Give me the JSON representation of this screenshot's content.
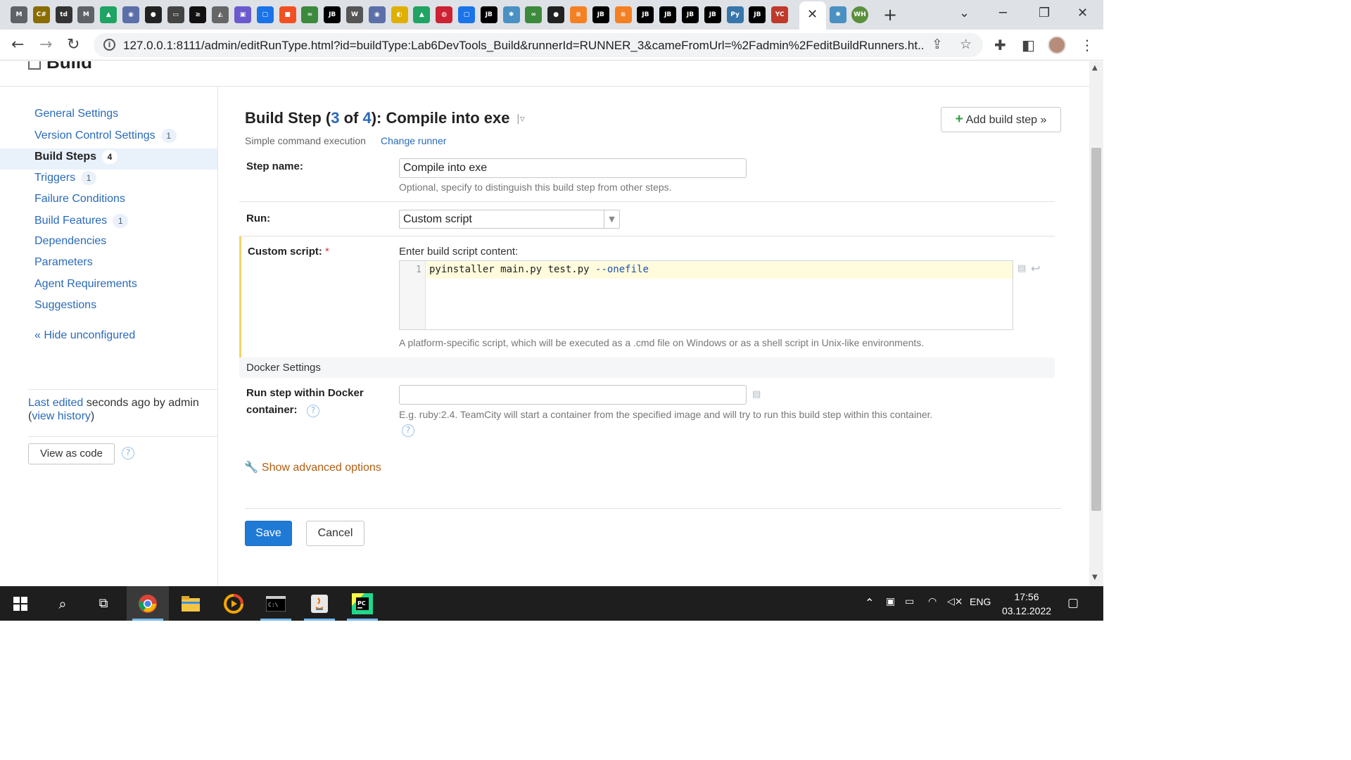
{
  "browser": {
    "tab_close": "✕",
    "new_tab": "+",
    "url": "127.0.0.1:8111/admin/editRunType.html?id=buildType:Lab6DevTools_Build&runnerId=RUNNER_3&cameFromUrl=%2Fadmin%2FeditBuildRunners.ht...",
    "pinned_tabs": [
      {
        "label": "M",
        "color": "#5f6368"
      },
      {
        "label": "C#",
        "color": "#8a6d00"
      },
      {
        "label": "td",
        "color": "#333333"
      },
      {
        "label": "M",
        "color": "#5f6368"
      },
      {
        "label": "▲",
        "color": "#1fa463"
      },
      {
        "label": "◉",
        "color": "#5b6fa8"
      },
      {
        "label": "●",
        "color": "#222222"
      },
      {
        "label": "▭",
        "color": "#444444"
      },
      {
        "label": "≥",
        "color": "#111111"
      },
      {
        "label": "◭",
        "color": "#666666"
      },
      {
        "label": "▣",
        "color": "#6a5acd"
      },
      {
        "label": "▢",
        "color": "#1a73e8"
      },
      {
        "label": "■",
        "color": "#f25022"
      },
      {
        "label": "∞",
        "color": "#3c8a3c"
      },
      {
        "label": "JB",
        "color": "#000000"
      },
      {
        "label": "W",
        "color": "#555555"
      },
      {
        "label": "◉",
        "color": "#5b6fa8"
      },
      {
        "label": "◐",
        "color": "#e0b000"
      },
      {
        "label": "▲",
        "color": "#1fa463"
      },
      {
        "label": "◍",
        "color": "#cc2233"
      },
      {
        "label": "▢",
        "color": "#1a73e8"
      },
      {
        "label": "JB",
        "color": "#000000"
      },
      {
        "label": "✱",
        "color": "#4a90c2"
      },
      {
        "label": "∞",
        "color": "#3c8a3c"
      },
      {
        "label": "●",
        "color": "#222222"
      },
      {
        "label": "≋",
        "color": "#f48024"
      },
      {
        "label": "JB",
        "color": "#000000"
      },
      {
        "label": "≋",
        "color": "#f48024"
      },
      {
        "label": "JB",
        "color": "#000000"
      },
      {
        "label": "JB",
        "color": "#000000"
      },
      {
        "label": "JB",
        "color": "#000000"
      },
      {
        "label": "JB",
        "color": "#000000"
      },
      {
        "label": "Py",
        "color": "#3776ab"
      },
      {
        "label": "JB",
        "color": "#000000"
      },
      {
        "label": "YC",
        "color": "#c0392b"
      }
    ],
    "extra_tabs": [
      {
        "label": "✱",
        "color": "#4a90c2"
      },
      {
        "label": "WH",
        "color": "#5a8f3c"
      }
    ]
  },
  "page": {
    "header_title": "Build"
  },
  "sidebar": {
    "items": [
      {
        "label": "General Settings",
        "badge": ""
      },
      {
        "label": "Version Control Settings",
        "badge": "1"
      },
      {
        "label": "Build Steps",
        "badge": "4"
      },
      {
        "label": "Triggers",
        "badge": "1"
      },
      {
        "label": "Failure Conditions",
        "badge": ""
      },
      {
        "label": "Build Features",
        "badge": "1"
      },
      {
        "label": "Dependencies",
        "badge": ""
      },
      {
        "label": "Parameters",
        "badge": ""
      },
      {
        "label": "Agent Requirements",
        "badge": ""
      },
      {
        "label": "Suggestions",
        "badge": ""
      }
    ],
    "hide_unconfigured": "« Hide unconfigured",
    "last_edited_link": "Last edited",
    "last_edited_text": " seconds ago by admin",
    "view_history_open": "(",
    "view_history": "view history",
    "view_history_close": ")",
    "view_as_code": "View as code",
    "help_glyph": "?"
  },
  "step": {
    "title_prefix": "Build Step (",
    "title_current": "3",
    "title_of": " of ",
    "title_total": "4",
    "title_suffix": "): Compile into exe",
    "title_menu": "|▿",
    "add_button": "Add build step »",
    "add_plus": "+",
    "runner_type": "Simple command execution",
    "change_runner": "Change runner",
    "step_name_label": "Step name:",
    "step_name_value": "Compile into exe",
    "step_name_note": "Optional, specify to distinguish this build step from other steps.",
    "run_label": "Run:",
    "run_value": "Custom script",
    "custom_script_label": "Custom script:",
    "required_marker": "*",
    "script_prompt": "Enter build script content:",
    "line_number": "1",
    "code_main": "pyinstaller main.py test.py ",
    "code_flag": "--onefile",
    "script_note": "A platform-specific script, which will be executed as a .cmd file on Windows or as a shell script in Unix-like environments.",
    "docker_header": "Docker Settings",
    "docker_label_1": "Run step within Docker",
    "docker_label_2": "container:",
    "docker_value": "",
    "docker_note": "E.g. ruby:2.4. TeamCity will start a container from the specified image and will try to run this build step within this container.",
    "advanced": "Show advanced options",
    "save": "Save",
    "cancel": "Cancel"
  },
  "taskbar": {
    "lang": "ENG",
    "time": "17:56",
    "date": "03.12.2022"
  }
}
